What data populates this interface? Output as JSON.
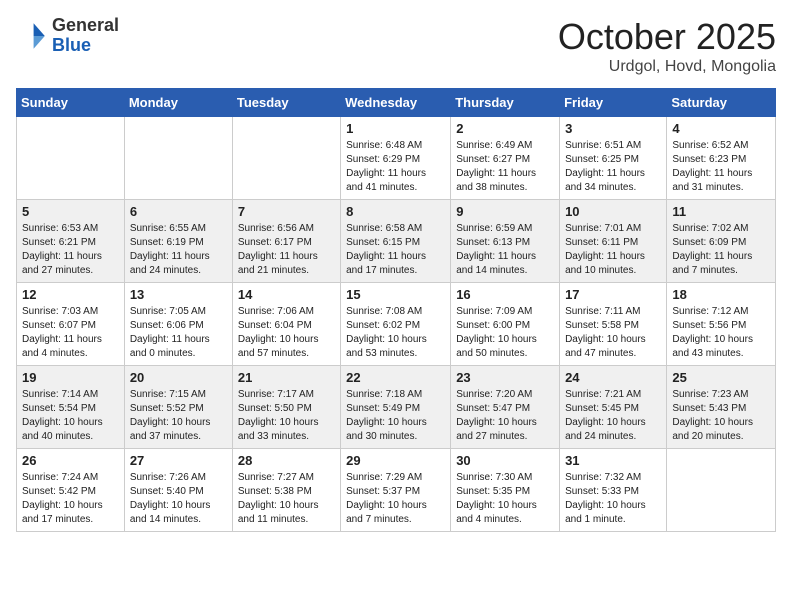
{
  "header": {
    "logo_general": "General",
    "logo_blue": "Blue",
    "month_title": "October 2025",
    "location": "Urdgol, Hovd, Mongolia"
  },
  "days_of_week": [
    "Sunday",
    "Monday",
    "Tuesday",
    "Wednesday",
    "Thursday",
    "Friday",
    "Saturday"
  ],
  "weeks": [
    [
      {
        "num": "",
        "info": ""
      },
      {
        "num": "",
        "info": ""
      },
      {
        "num": "",
        "info": ""
      },
      {
        "num": "1",
        "info": "Sunrise: 6:48 AM\nSunset: 6:29 PM\nDaylight: 11 hours\nand 41 minutes."
      },
      {
        "num": "2",
        "info": "Sunrise: 6:49 AM\nSunset: 6:27 PM\nDaylight: 11 hours\nand 38 minutes."
      },
      {
        "num": "3",
        "info": "Sunrise: 6:51 AM\nSunset: 6:25 PM\nDaylight: 11 hours\nand 34 minutes."
      },
      {
        "num": "4",
        "info": "Sunrise: 6:52 AM\nSunset: 6:23 PM\nDaylight: 11 hours\nand 31 minutes."
      }
    ],
    [
      {
        "num": "5",
        "info": "Sunrise: 6:53 AM\nSunset: 6:21 PM\nDaylight: 11 hours\nand 27 minutes."
      },
      {
        "num": "6",
        "info": "Sunrise: 6:55 AM\nSunset: 6:19 PM\nDaylight: 11 hours\nand 24 minutes."
      },
      {
        "num": "7",
        "info": "Sunrise: 6:56 AM\nSunset: 6:17 PM\nDaylight: 11 hours\nand 21 minutes."
      },
      {
        "num": "8",
        "info": "Sunrise: 6:58 AM\nSunset: 6:15 PM\nDaylight: 11 hours\nand 17 minutes."
      },
      {
        "num": "9",
        "info": "Sunrise: 6:59 AM\nSunset: 6:13 PM\nDaylight: 11 hours\nand 14 minutes."
      },
      {
        "num": "10",
        "info": "Sunrise: 7:01 AM\nSunset: 6:11 PM\nDaylight: 11 hours\nand 10 minutes."
      },
      {
        "num": "11",
        "info": "Sunrise: 7:02 AM\nSunset: 6:09 PM\nDaylight: 11 hours\nand 7 minutes."
      }
    ],
    [
      {
        "num": "12",
        "info": "Sunrise: 7:03 AM\nSunset: 6:07 PM\nDaylight: 11 hours\nand 4 minutes."
      },
      {
        "num": "13",
        "info": "Sunrise: 7:05 AM\nSunset: 6:06 PM\nDaylight: 11 hours\nand 0 minutes."
      },
      {
        "num": "14",
        "info": "Sunrise: 7:06 AM\nSunset: 6:04 PM\nDaylight: 10 hours\nand 57 minutes."
      },
      {
        "num": "15",
        "info": "Sunrise: 7:08 AM\nSunset: 6:02 PM\nDaylight: 10 hours\nand 53 minutes."
      },
      {
        "num": "16",
        "info": "Sunrise: 7:09 AM\nSunset: 6:00 PM\nDaylight: 10 hours\nand 50 minutes."
      },
      {
        "num": "17",
        "info": "Sunrise: 7:11 AM\nSunset: 5:58 PM\nDaylight: 10 hours\nand 47 minutes."
      },
      {
        "num": "18",
        "info": "Sunrise: 7:12 AM\nSunset: 5:56 PM\nDaylight: 10 hours\nand 43 minutes."
      }
    ],
    [
      {
        "num": "19",
        "info": "Sunrise: 7:14 AM\nSunset: 5:54 PM\nDaylight: 10 hours\nand 40 minutes."
      },
      {
        "num": "20",
        "info": "Sunrise: 7:15 AM\nSunset: 5:52 PM\nDaylight: 10 hours\nand 37 minutes."
      },
      {
        "num": "21",
        "info": "Sunrise: 7:17 AM\nSunset: 5:50 PM\nDaylight: 10 hours\nand 33 minutes."
      },
      {
        "num": "22",
        "info": "Sunrise: 7:18 AM\nSunset: 5:49 PM\nDaylight: 10 hours\nand 30 minutes."
      },
      {
        "num": "23",
        "info": "Sunrise: 7:20 AM\nSunset: 5:47 PM\nDaylight: 10 hours\nand 27 minutes."
      },
      {
        "num": "24",
        "info": "Sunrise: 7:21 AM\nSunset: 5:45 PM\nDaylight: 10 hours\nand 24 minutes."
      },
      {
        "num": "25",
        "info": "Sunrise: 7:23 AM\nSunset: 5:43 PM\nDaylight: 10 hours\nand 20 minutes."
      }
    ],
    [
      {
        "num": "26",
        "info": "Sunrise: 7:24 AM\nSunset: 5:42 PM\nDaylight: 10 hours\nand 17 minutes."
      },
      {
        "num": "27",
        "info": "Sunrise: 7:26 AM\nSunset: 5:40 PM\nDaylight: 10 hours\nand 14 minutes."
      },
      {
        "num": "28",
        "info": "Sunrise: 7:27 AM\nSunset: 5:38 PM\nDaylight: 10 hours\nand 11 minutes."
      },
      {
        "num": "29",
        "info": "Sunrise: 7:29 AM\nSunset: 5:37 PM\nDaylight: 10 hours\nand 7 minutes."
      },
      {
        "num": "30",
        "info": "Sunrise: 7:30 AM\nSunset: 5:35 PM\nDaylight: 10 hours\nand 4 minutes."
      },
      {
        "num": "31",
        "info": "Sunrise: 7:32 AM\nSunset: 5:33 PM\nDaylight: 10 hours\nand 1 minute."
      },
      {
        "num": "",
        "info": ""
      }
    ]
  ]
}
